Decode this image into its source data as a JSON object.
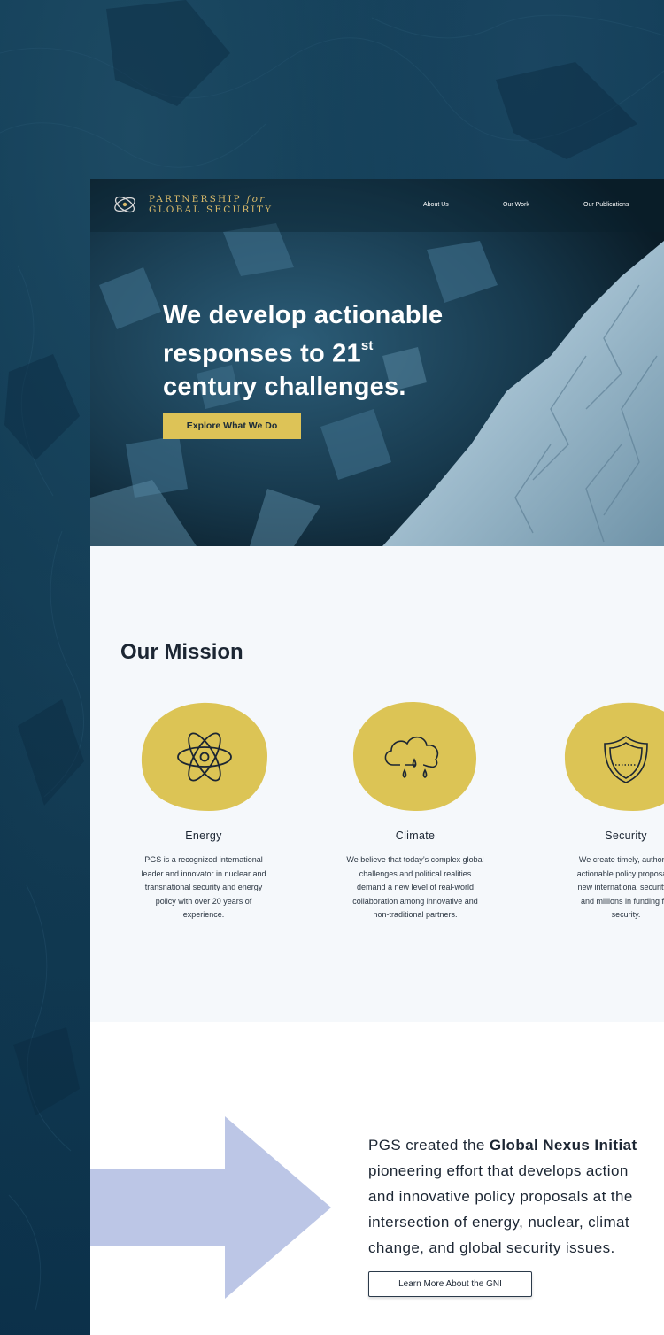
{
  "brand": {
    "line1_a": "PARTNERSHIP",
    "line1_b": "for",
    "line2": "GLOBAL SECURITY",
    "gold": "#d8b96a"
  },
  "nav": {
    "items": [
      {
        "label": "About Us"
      },
      {
        "label": "Our Work"
      },
      {
        "label": "Our Publications"
      }
    ]
  },
  "hero": {
    "line1": "We develop actionable",
    "line2_a": "responses to 21",
    "line2_sup": "st",
    "line3": "century challenges.",
    "cta_label": "Explore What We Do"
  },
  "mission": {
    "title": "Our Mission",
    "cards": [
      {
        "title": "Energy",
        "icon": "atom-icon",
        "lines": [
          "PGS is a recognized international",
          "leader and innovator in nuclear and",
          "transnational security and energy",
          "policy with over 20 years of",
          "experience."
        ]
      },
      {
        "title": "Climate",
        "icon": "rain-cloud-icon",
        "lines": [
          "We believe that today’s complex global",
          "challenges and political realities",
          "demand a new level of real-world",
          "collaboration among innovative and",
          "non-traditional partners."
        ]
      },
      {
        "title": "Security",
        "icon": "shield-icon",
        "lines": [
          "We create timely, authorita",
          "actionable policy proposals,",
          "new international security p",
          "and millions in funding for",
          "security."
        ]
      }
    ]
  },
  "gni": {
    "line1_a": "PGS created the ",
    "line1_b": "Global Nexus Initiat",
    "line2": "pioneering effort that develops action",
    "line3": "and innovative policy proposals at the",
    "line4": "intersection of energy, nuclear, climat",
    "line5": "change, and global security issues.",
    "cta_label": "Learn More About the GNI"
  },
  "colors": {
    "accent_gold": "#ddc357",
    "arrow": "#bcc6e6",
    "dark_navy": "#0f3b55"
  }
}
